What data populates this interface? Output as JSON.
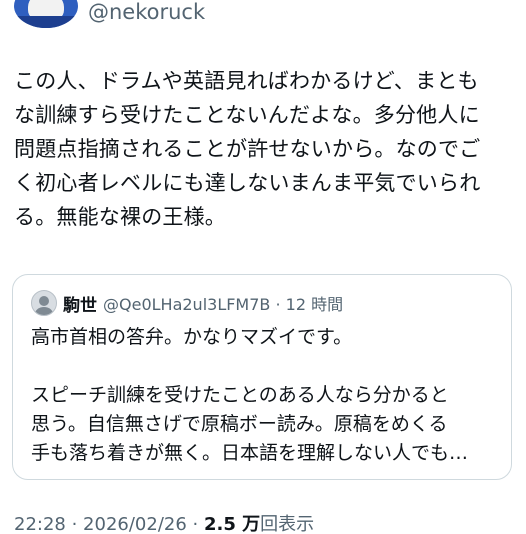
{
  "author": {
    "handle": "@nekoruck"
  },
  "tweet": {
    "text": "この人、ドラムや英語見ればわかるけど、まとも\nな訓練すら受けたことないんだよな。多分他人に\n問題点指摘されることが許せないから。なのでご\nく初心者レベルにも達しないまんま平気でいられ\nる。無能な裸の王様。"
  },
  "quote": {
    "name": "駒世",
    "handle_time": "@Qe0LHa2ul3LFM7B · 12 時間",
    "text": "高市首相の答弁。かなりマズイです。\n\nスピーチ訓練を受けたことのある人なら分かると\n思う。自信無さげで原稿ボー読み。原稿をめくる\n手も落ち着きが無く。日本語を理解しない人でも…"
  },
  "meta": {
    "timestamp": "22:28 · 2026/02/26 · ",
    "views_count": "2.5 万",
    "views_label": "回表示"
  }
}
